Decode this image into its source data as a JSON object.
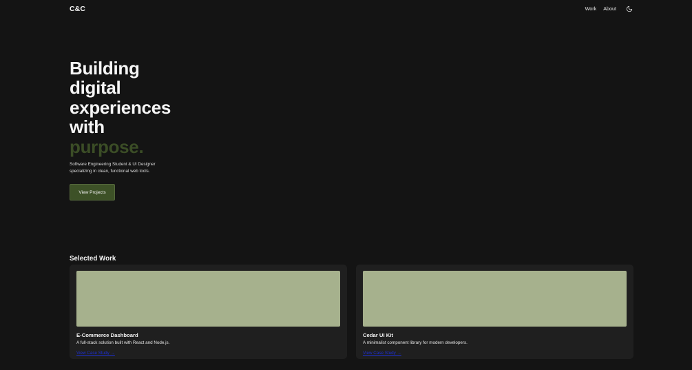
{
  "header": {
    "logo": "C&C",
    "nav": [
      {
        "label": "Work"
      },
      {
        "label": "About"
      }
    ],
    "theme_toggle_icon": "moon-icon"
  },
  "hero": {
    "title_lines": [
      "Building",
      "digital",
      "experiences",
      "with"
    ],
    "title_accent": "purpose.",
    "subtitle_lines": [
      "Software Engineering Student & UI Designer",
      "specializing in clean, functional web tools."
    ],
    "cta_label": "View Projects"
  },
  "work": {
    "section_title": "Selected Work",
    "projects": [
      {
        "title": "E-Commerce Dashboard",
        "description": "A full-stack solution built with React and Node.js.",
        "link_label": "View Case Study →"
      },
      {
        "title": "Cedar UI Kit",
        "description": "A minimalist component library for modern developers.",
        "link_label": "View Case Study →"
      }
    ]
  },
  "colors": {
    "background": "#141414",
    "accent": "#3b4d26",
    "button": "#3d5127",
    "card": "#1f1f1f",
    "card_image": "#a6b18d",
    "link": "#1d2fd0"
  }
}
